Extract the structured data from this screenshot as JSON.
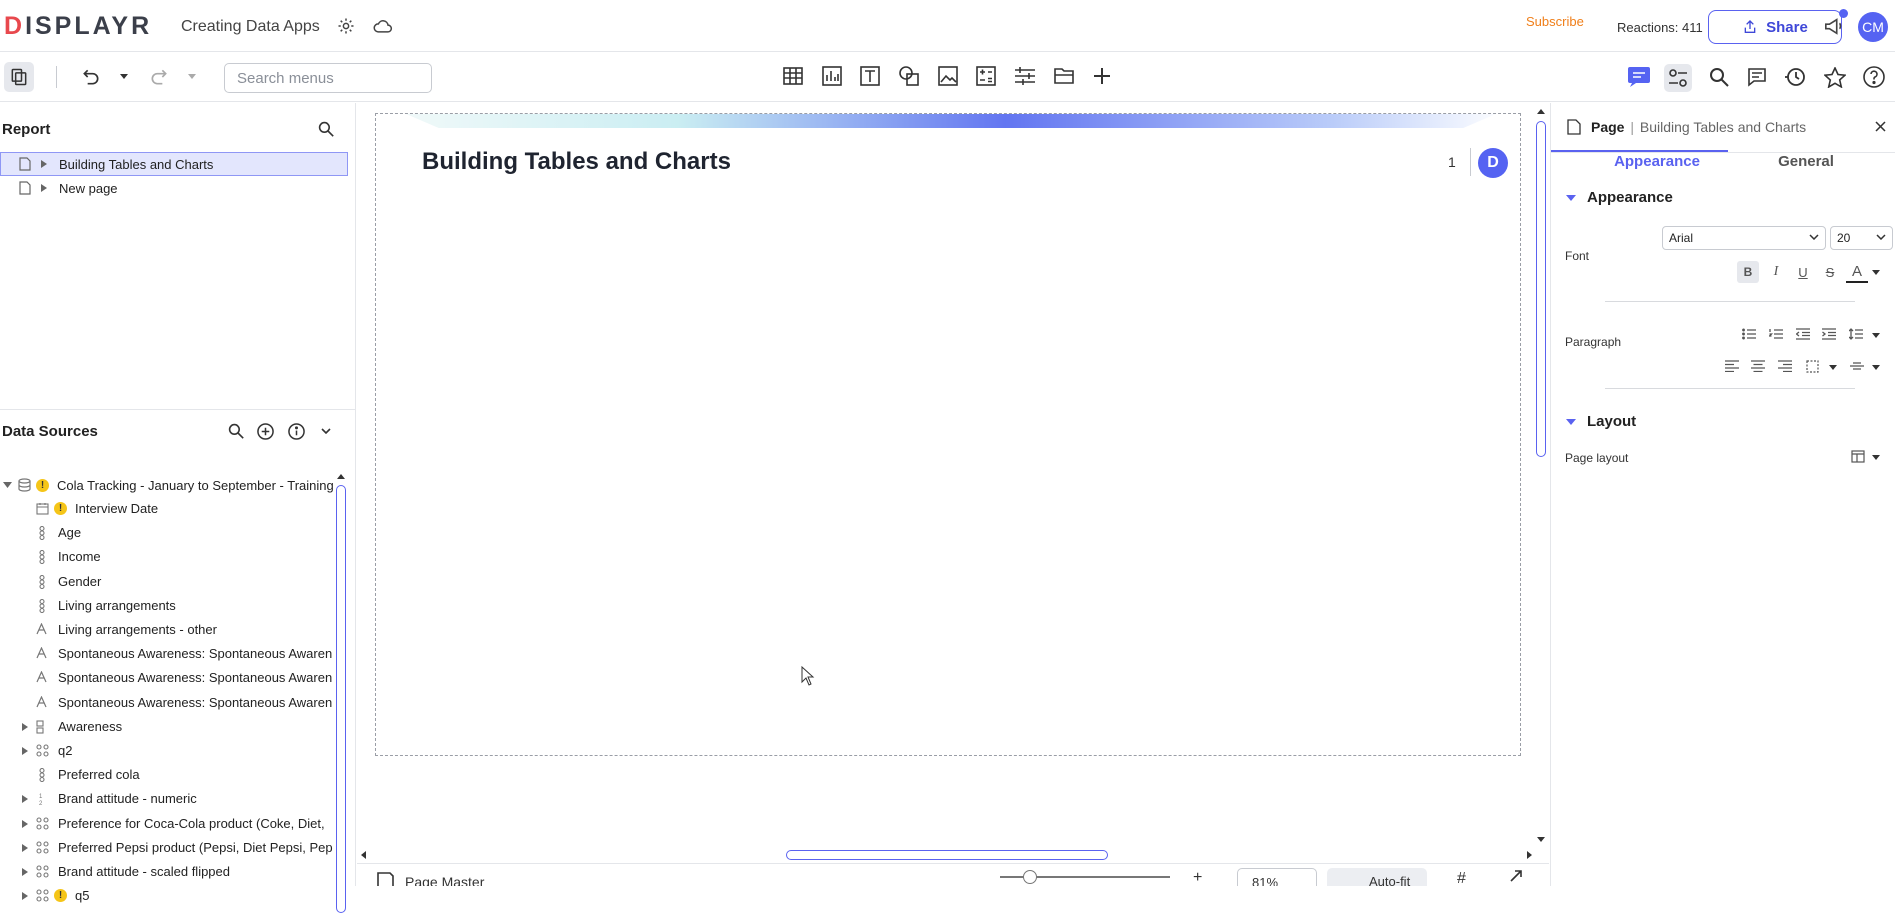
{
  "app": {
    "logo_text": "DISPLAYR",
    "doc_title": "Creating Data Apps",
    "subscribe": "Subscribe",
    "reactions": "Reactions: 411",
    "share": "Share",
    "user_initials": "CM"
  },
  "toolbar": {
    "search_placeholder": "Search menus"
  },
  "report": {
    "title": "Report",
    "pages": [
      {
        "label": "Building Tables and Charts",
        "selected": true
      },
      {
        "label": "New page",
        "selected": false
      }
    ]
  },
  "datasources": {
    "title": "Data Sources",
    "root": "Cola Tracking - January to September - Training",
    "items": [
      {
        "label": "Interview Date",
        "icon": "calendar-icon",
        "warn": true,
        "expand": false
      },
      {
        "label": "Age",
        "icon": "categorical-icon",
        "warn": false,
        "expand": false
      },
      {
        "label": "Income",
        "icon": "categorical-icon",
        "warn": false,
        "expand": false
      },
      {
        "label": "Gender",
        "icon": "categorical-icon",
        "warn": false,
        "expand": false
      },
      {
        "label": "Living arrangements",
        "icon": "categorical-icon",
        "warn": false,
        "expand": false
      },
      {
        "label": "Living arrangements - other",
        "icon": "text-icon",
        "warn": false,
        "expand": false
      },
      {
        "label": "Spontaneous Awareness: Spontaneous Awaren",
        "icon": "text-icon",
        "warn": false,
        "expand": false
      },
      {
        "label": "Spontaneous Awareness: Spontaneous Awaren",
        "icon": "text-icon",
        "warn": false,
        "expand": false
      },
      {
        "label": "Spontaneous Awareness: Spontaneous Awaren",
        "icon": "text-icon",
        "warn": false,
        "expand": false
      },
      {
        "label": "Awareness",
        "icon": "binary-set-icon",
        "warn": false,
        "expand": true
      },
      {
        "label": "q2",
        "icon": "grid-icon",
        "warn": false,
        "expand": true
      },
      {
        "label": "Preferred cola",
        "icon": "categorical-icon",
        "warn": false,
        "expand": false
      },
      {
        "label": "Brand attitude - numeric",
        "icon": "numeric-icon",
        "warn": false,
        "expand": true
      },
      {
        "label": "Preference for Coca-Cola product (Coke, Diet,",
        "icon": "grid-icon",
        "warn": false,
        "expand": true
      },
      {
        "label": "Preferred Pepsi product (Pepsi, Diet Pepsi, Pep",
        "icon": "grid-icon",
        "warn": false,
        "expand": true
      },
      {
        "label": "Brand attitude - scaled flipped",
        "icon": "grid-icon",
        "warn": false,
        "expand": true
      },
      {
        "label": "q5",
        "icon": "grid-icon",
        "warn": true,
        "expand": true
      }
    ]
  },
  "page": {
    "heading": "Building Tables and Charts",
    "number": "1",
    "badge": "D"
  },
  "bottombar": {
    "page_master": "Page Master",
    "zoom": "81%",
    "autofit": "Auto-fit"
  },
  "rightpanel": {
    "kind": "Page",
    "name": "Building Tables and Charts",
    "tabs": [
      {
        "label": "Appearance",
        "active": true
      },
      {
        "label": "General",
        "active": false
      }
    ],
    "appearance_title": "Appearance",
    "font_label": "Font",
    "font_family": "Arial",
    "font_size": "20",
    "paragraph_label": "Paragraph",
    "layout_title": "Layout",
    "page_layout_label": "Page layout"
  },
  "colors": {
    "accent": "#5563f2",
    "subscribe": "#f07f1a",
    "warning": "#f5c518"
  }
}
